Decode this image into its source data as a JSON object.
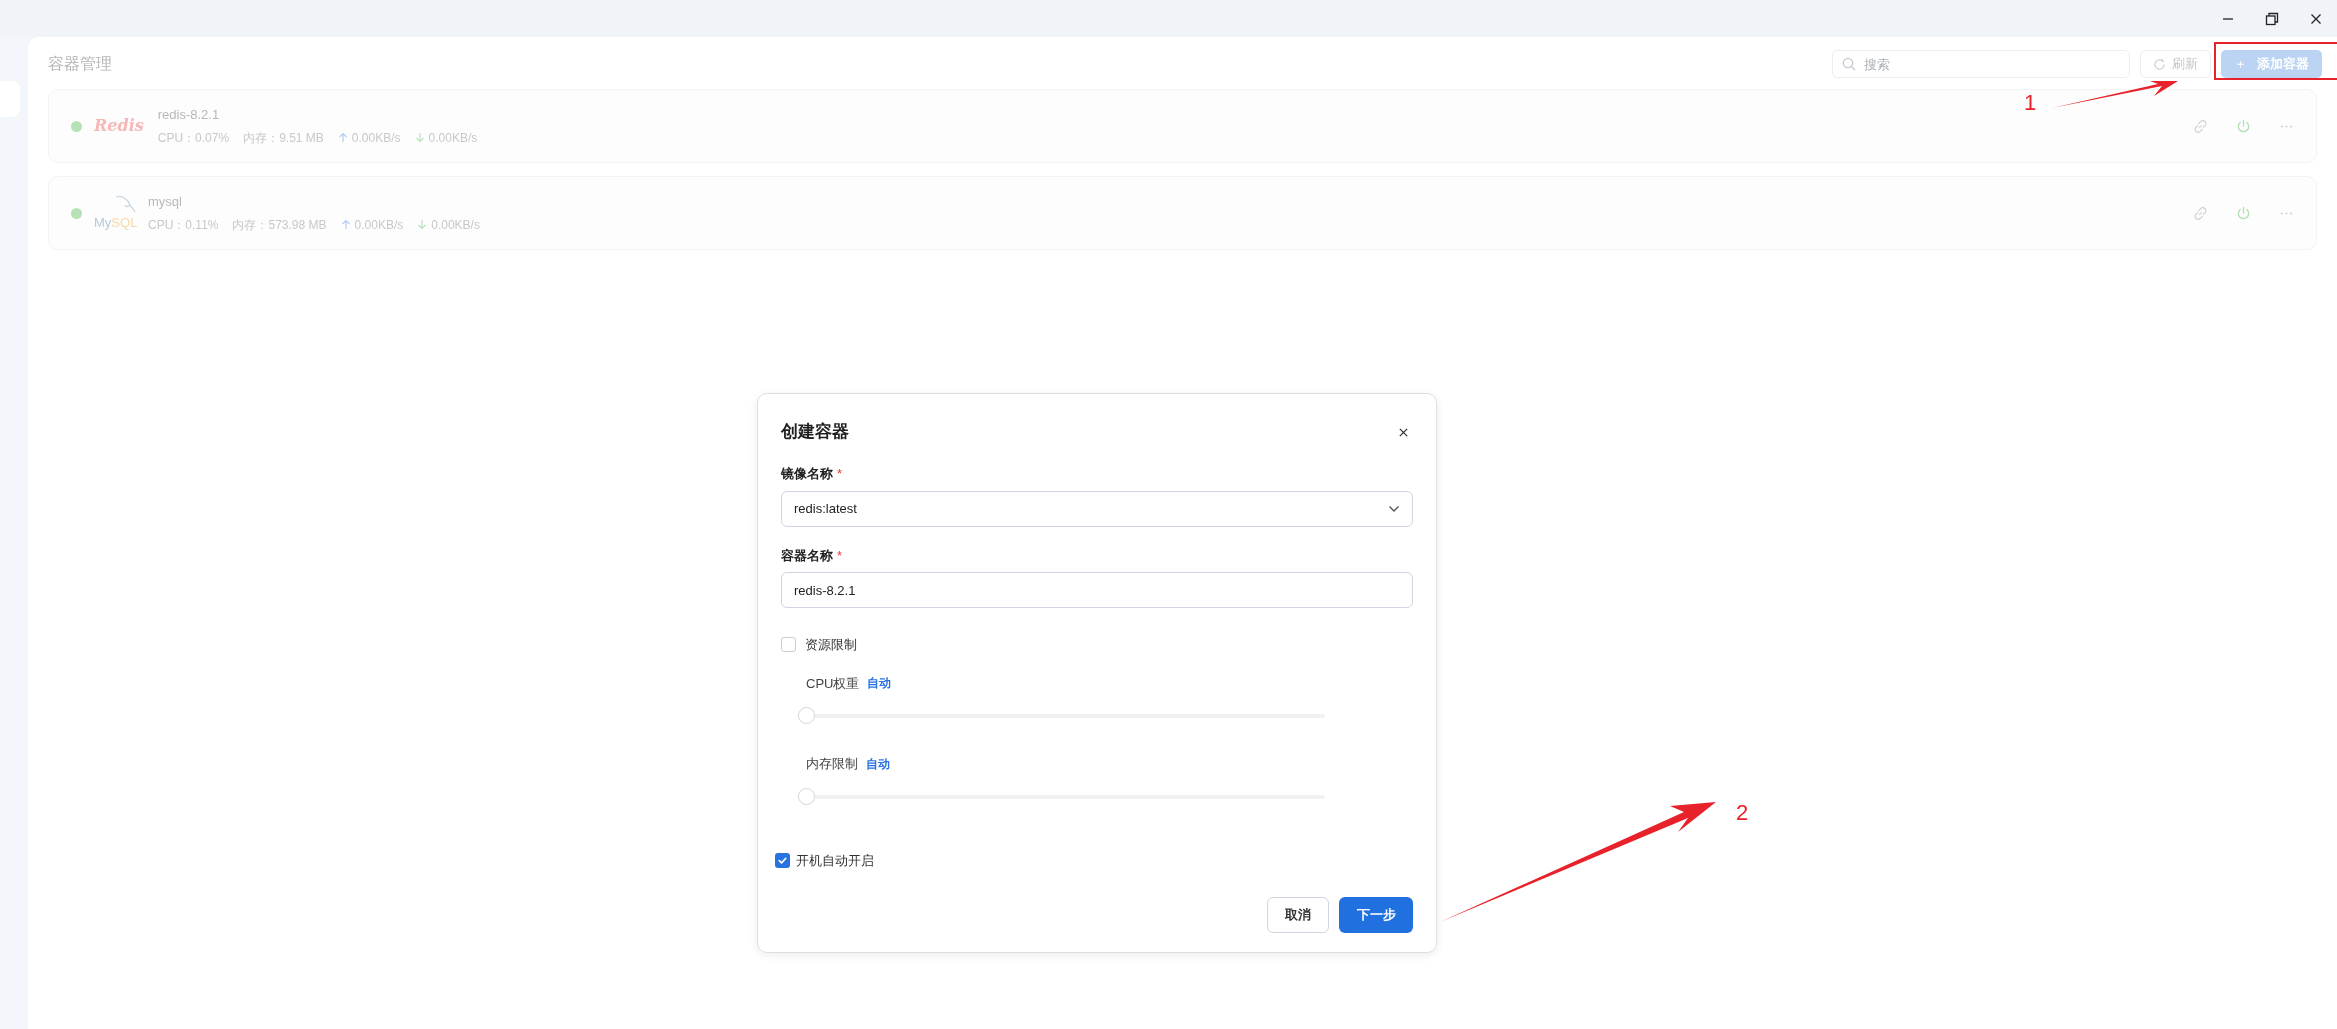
{
  "page": {
    "title": "容器管理"
  },
  "toolbar": {
    "search": {
      "placeholder": "搜索"
    },
    "refresh": "刷新",
    "add_button": {
      "icon": "＋",
      "label": "添加容器"
    }
  },
  "containers": [
    {
      "name": "redis-8.2.1",
      "logo": {
        "kind": "redis",
        "parts": [
          "Redis"
        ]
      },
      "color": "#b5e3b5",
      "cpu": "CPU：0.07%",
      "memory": "内存：9.51 MB",
      "upload": "0.00KB/s",
      "download": "0.00KB/s"
    },
    {
      "name": "mysql",
      "logo": {
        "kind": "mysql",
        "parts": [
          "My",
          "SQL"
        ]
      },
      "color": "#b5e3b5",
      "cpu": "CPU：0.11%",
      "memory": "内存：573.98 MB",
      "upload": "0.00KB/s",
      "download": "0.00KB/s"
    }
  ],
  "dialog": {
    "title": "创建容器",
    "fields": [
      {
        "label": "镜像名称",
        "required_mark": "*",
        "kind": "select",
        "value": "redis:latest"
      },
      {
        "label": "容器名称",
        "required_mark": "*",
        "kind": "text",
        "value": "redis-8.2.1"
      }
    ],
    "resource_limit": {
      "label": "资源限制",
      "checked": false,
      "sliders": [
        {
          "label": "CPU权重",
          "reading": "自动",
          "level": 0
        },
        {
          "label": "内存限制",
          "reading": "自动",
          "level": 0
        }
      ]
    },
    "autostart": {
      "label": "开机自动开启",
      "checked": true
    },
    "buttons": [
      {
        "label": "取消",
        "kind": "secondary"
      },
      {
        "label": "下一步",
        "kind": "primary"
      }
    ]
  },
  "annotations": [
    {
      "label": "1"
    },
    {
      "label": "2"
    }
  ]
}
